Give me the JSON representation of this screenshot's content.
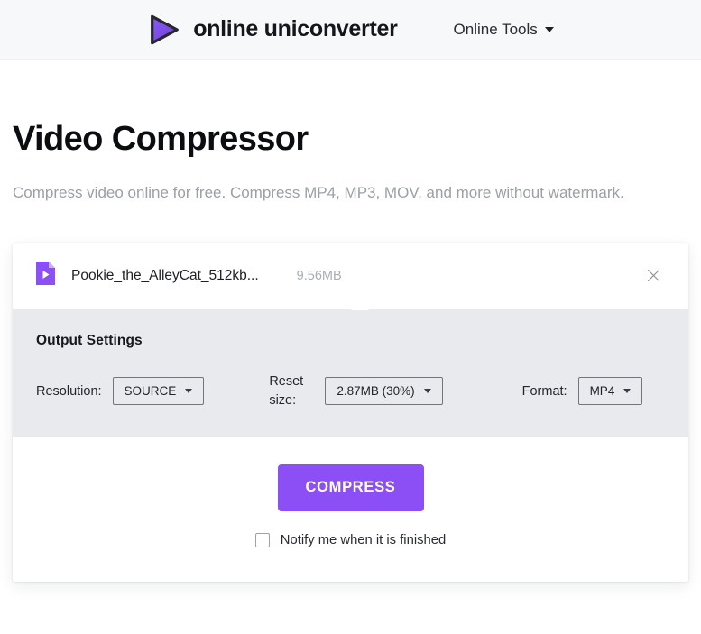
{
  "header": {
    "brand_name": "online uniconverter",
    "logo_icon": "play-triangle-logo",
    "nav": {
      "label": "Online Tools",
      "caret_icon": "chevron-down-icon"
    }
  },
  "main": {
    "title": "Video Compressor",
    "subtitle": "Compress video online for free. Compress MP4, MP3, MOV, and more without watermark."
  },
  "card": {
    "file": {
      "icon": "video-file-icon",
      "name": "Pookie_the_AlleyCat_512kb...",
      "size": "9.56MB",
      "remove_icon": "close-icon"
    },
    "settings": {
      "title": "Output Settings",
      "controls": [
        {
          "label": "Resolution:",
          "value": "SOURCE",
          "name": "resolution-select"
        },
        {
          "label": "Reset size:",
          "value": "2.87MB (30%)",
          "name": "reset-size-select"
        },
        {
          "label": "Format:",
          "value": "MP4",
          "name": "format-select"
        }
      ]
    },
    "actions": {
      "compress_label": "COMPRESS",
      "notify_label": "Notify me when it is finished",
      "notify_checked": false
    }
  },
  "colors": {
    "accent": "#8b4ff5",
    "panel_bg": "#e8eaee",
    "header_bg": "#f7f8fa",
    "muted_text": "#9b9fa6"
  }
}
